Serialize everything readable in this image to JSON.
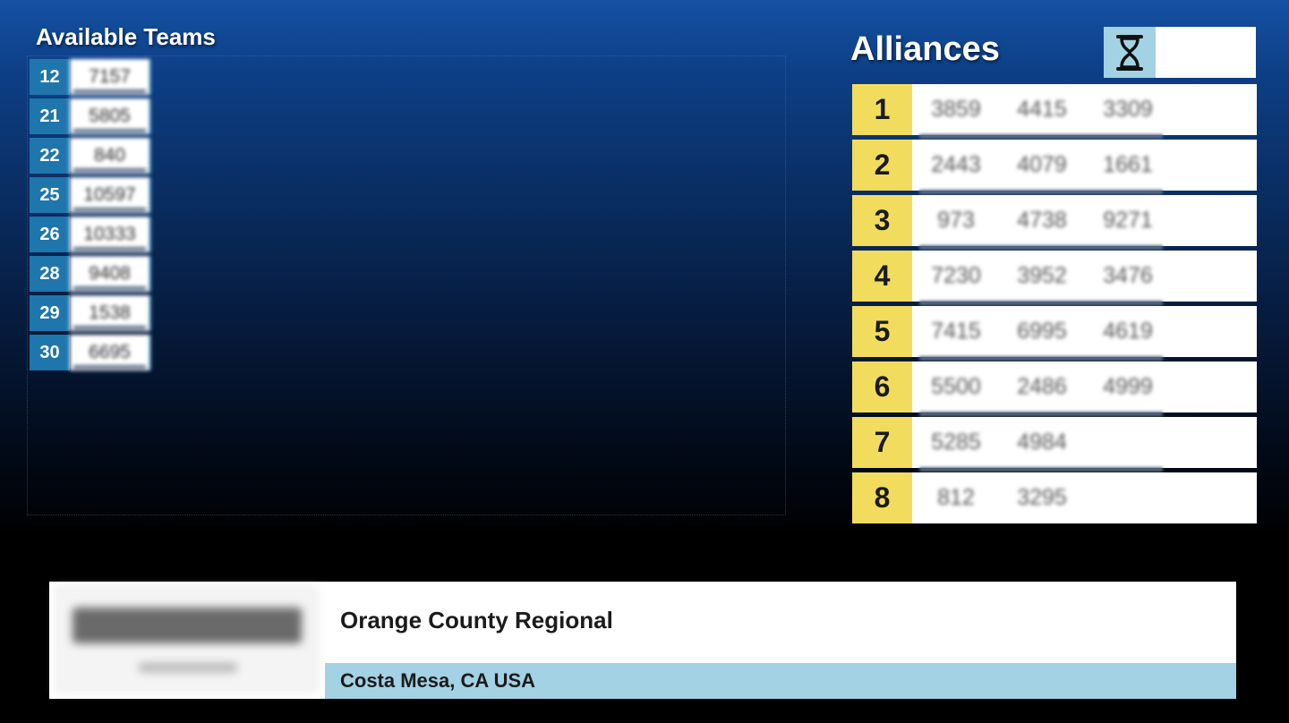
{
  "available": {
    "title": "Available Teams",
    "teams": [
      {
        "rank": "12",
        "number": "7157"
      },
      {
        "rank": "21",
        "number": "5805"
      },
      {
        "rank": "22",
        "number": "840"
      },
      {
        "rank": "25",
        "number": "10597"
      },
      {
        "rank": "26",
        "number": "10333"
      },
      {
        "rank": "28",
        "number": "9408"
      },
      {
        "rank": "29",
        "number": "1538"
      },
      {
        "rank": "30",
        "number": "6695"
      }
    ]
  },
  "alliances": {
    "title": "Alliances",
    "timer_icon": "hourglass-icon",
    "rows": [
      {
        "seed": "1",
        "teams": [
          "3859",
          "4415",
          "3309"
        ]
      },
      {
        "seed": "2",
        "teams": [
          "2443",
          "4079",
          "1661"
        ]
      },
      {
        "seed": "3",
        "teams": [
          "973",
          "4738",
          "9271"
        ]
      },
      {
        "seed": "4",
        "teams": [
          "7230",
          "3952",
          "3476"
        ]
      },
      {
        "seed": "5",
        "teams": [
          "7415",
          "6995",
          "4619"
        ]
      },
      {
        "seed": "6",
        "teams": [
          "5500",
          "2486",
          "4999"
        ]
      },
      {
        "seed": "7",
        "teams": [
          "5285",
          "4984",
          ""
        ]
      },
      {
        "seed": "8",
        "teams": [
          "812",
          "3295",
          ""
        ]
      }
    ]
  },
  "event": {
    "name": "Orange County Regional",
    "location": "Costa Mesa, CA USA"
  },
  "colors": {
    "rank_blue": "#1f76ad",
    "seed_yellow": "#f2dc5d",
    "light_blue": "#a3d2e4"
  }
}
